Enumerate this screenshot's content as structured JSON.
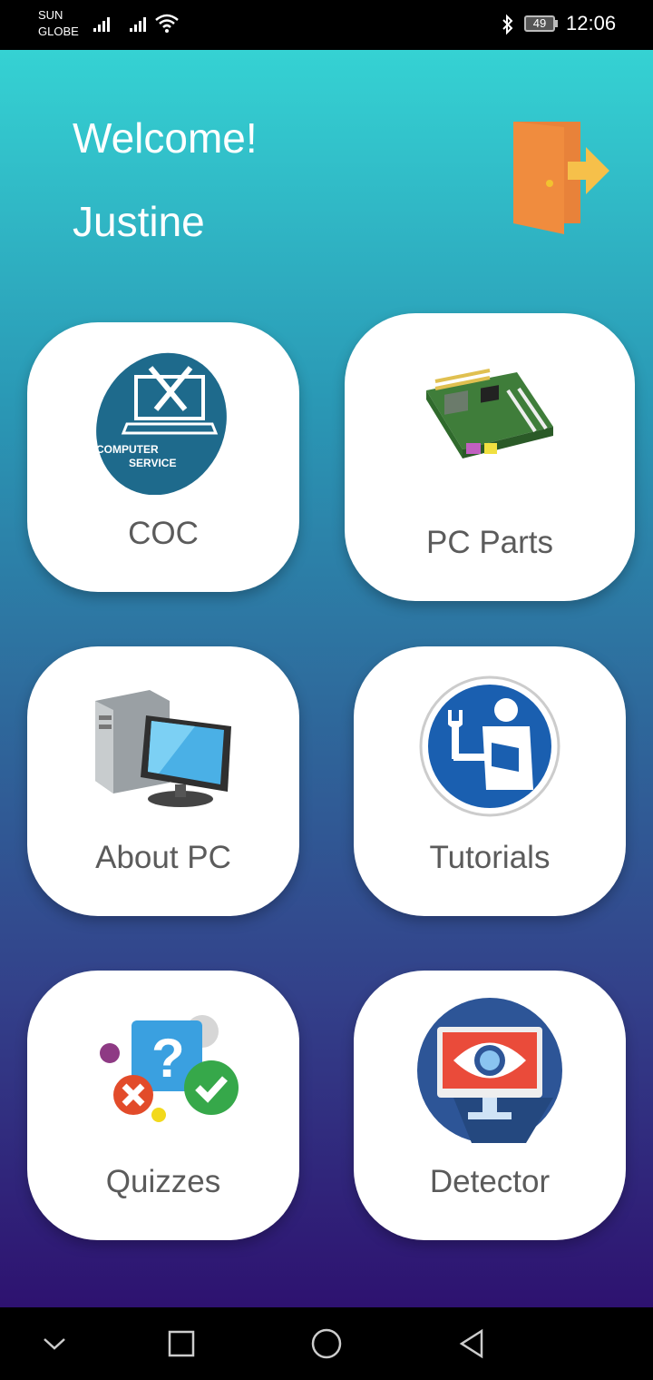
{
  "status_bar": {
    "carrier_1": "SUN",
    "carrier_2": "GLOBE",
    "battery": "49",
    "time": "12:06"
  },
  "header": {
    "greeting": "Welcome!",
    "username": "Justine",
    "logout_icon": "door-exit-icon"
  },
  "menu": {
    "coc": {
      "label": "COC",
      "icon": "computer-service-icon",
      "icon_text_1": "COMPUTER",
      "icon_text_2": "SERVICE"
    },
    "pc_parts": {
      "label": "PC Parts",
      "icon": "motherboard-icon"
    },
    "about_pc": {
      "label": "About PC",
      "icon": "desktop-computer-icon"
    },
    "tutorials": {
      "label": "Tutorials",
      "icon": "reading-person-icon"
    },
    "quizzes": {
      "label": "Quizzes",
      "icon": "quiz-icon"
    },
    "detector": {
      "label": "Detector",
      "icon": "eye-monitor-icon"
    }
  },
  "nav_bar": {
    "items": [
      "back-chevron-icon",
      "recents-square-icon",
      "home-circle-icon",
      "back-triangle-icon"
    ]
  },
  "colors": {
    "gradient_top": "#35d2d3",
    "gradient_bottom": "#2e1270",
    "card": "#ffffff",
    "label_text": "#5b5b5b"
  }
}
